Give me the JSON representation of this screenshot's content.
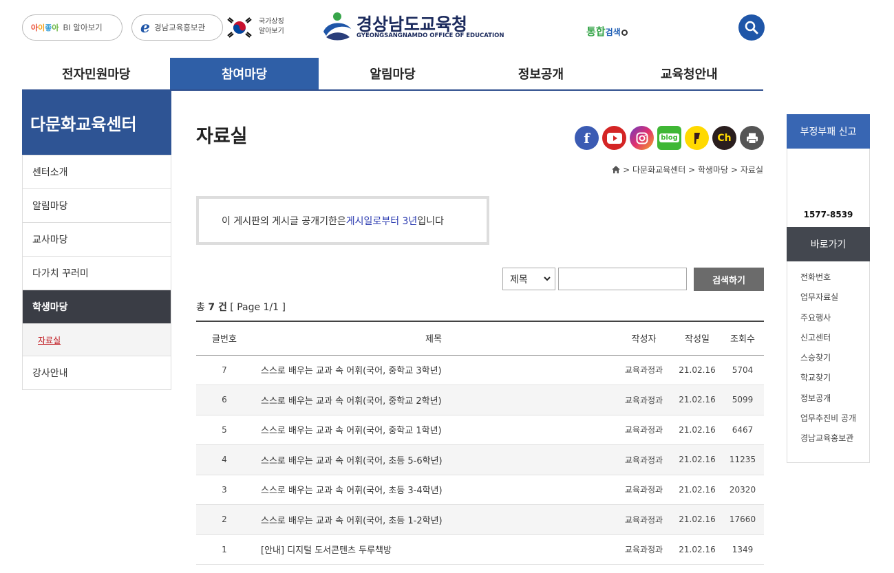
{
  "header": {
    "bi_logo": {
      "p1": "아",
      "p2": "이",
      "p3": "좋",
      "p4": "아"
    },
    "bi_label": "BI 알아보기",
    "promo_label": "경남교육홍보관",
    "national_symbol": "국가상징 알아보기",
    "logo_kr": "경상남도교육청",
    "logo_en": "GYEONGSANGNAMDO OFFICE OF EDUCATION",
    "unified_search_1": "통합",
    "unified_search_2": "검색"
  },
  "nav": [
    "전자민원마당",
    "참여마당",
    "알림마당",
    "정보공개",
    "교육청안내"
  ],
  "sidebar": {
    "title": "다문화교육센터",
    "items": [
      "센터소개",
      "알림마당",
      "교사마당",
      "다가치 꾸러미",
      "학생마당"
    ],
    "sub_item": "자료실",
    "last_item": "강사안내"
  },
  "content": {
    "title": "자료실",
    "breadcrumb": {
      "l1": "다문화교육센터",
      "l2": "학생마당",
      "l3": "자료실"
    },
    "notice": {
      "before": "이 게시판의 게시글 공개기한은 ",
      "highlight": "게시일로부터 3년",
      "after": "입니다"
    },
    "search": {
      "select_value": "제목",
      "button": "검색하기"
    },
    "total": {
      "prefix": "총 ",
      "count": "7 건",
      "page": " [ Page 1/1 ]"
    },
    "table": {
      "headers": [
        "글번호",
        "제목",
        "작성자",
        "작성일",
        "조회수"
      ],
      "rows": [
        {
          "no": "7",
          "title": "스스로 배우는 교과 속 어휘(국어, 중학교 3학년)",
          "author": "교육과정과",
          "date": "21.02.16",
          "views": "5704"
        },
        {
          "no": "6",
          "title": "스스로 배우는 교과 속 어휘(국어, 중학교 2학년)",
          "author": "교육과정과",
          "date": "21.02.16",
          "views": "5099"
        },
        {
          "no": "5",
          "title": "스스로 배우는 교과 속 어휘(국어, 중학교 1학년)",
          "author": "교육과정과",
          "date": "21.02.16",
          "views": "6467"
        },
        {
          "no": "4",
          "title": "스스로 배우는 교과 속 어휘(국어, 초등 5-6학년)",
          "author": "교육과정과",
          "date": "21.02.16",
          "views": "11235"
        },
        {
          "no": "3",
          "title": "스스로 배우는 교과 속 어휘(국어, 초등 3-4학년)",
          "author": "교육과정과",
          "date": "21.02.16",
          "views": "20320"
        },
        {
          "no": "2",
          "title": "스스로 배우는 교과 속 어휘(국어, 초등 1-2학년)",
          "author": "교육과정과",
          "date": "21.02.16",
          "views": "17660"
        },
        {
          "no": "1",
          "title": "[안내] 디지털 도서콘텐츠 두루책방",
          "author": "교육과정과",
          "date": "21.02.16",
          "views": "1349"
        }
      ]
    }
  },
  "quick": {
    "report": "부정부패 신고",
    "phone": "1577-8539",
    "head": "바로가기",
    "links": [
      "전화번호",
      "업무자료실",
      "주요행사",
      "신고센터",
      "스승찾기",
      "학교찾기",
      "정보공개",
      "업무추진비 공개",
      "경남교육홍보관"
    ]
  },
  "sns": {
    "youtube_icon": "youtube-icon",
    "blog_label": "blog",
    "kakao_label": "Ch"
  },
  "colors": {
    "primary": "#2f5fa7",
    "dark": "#3a3d45",
    "accent_red": "#c0191f"
  }
}
